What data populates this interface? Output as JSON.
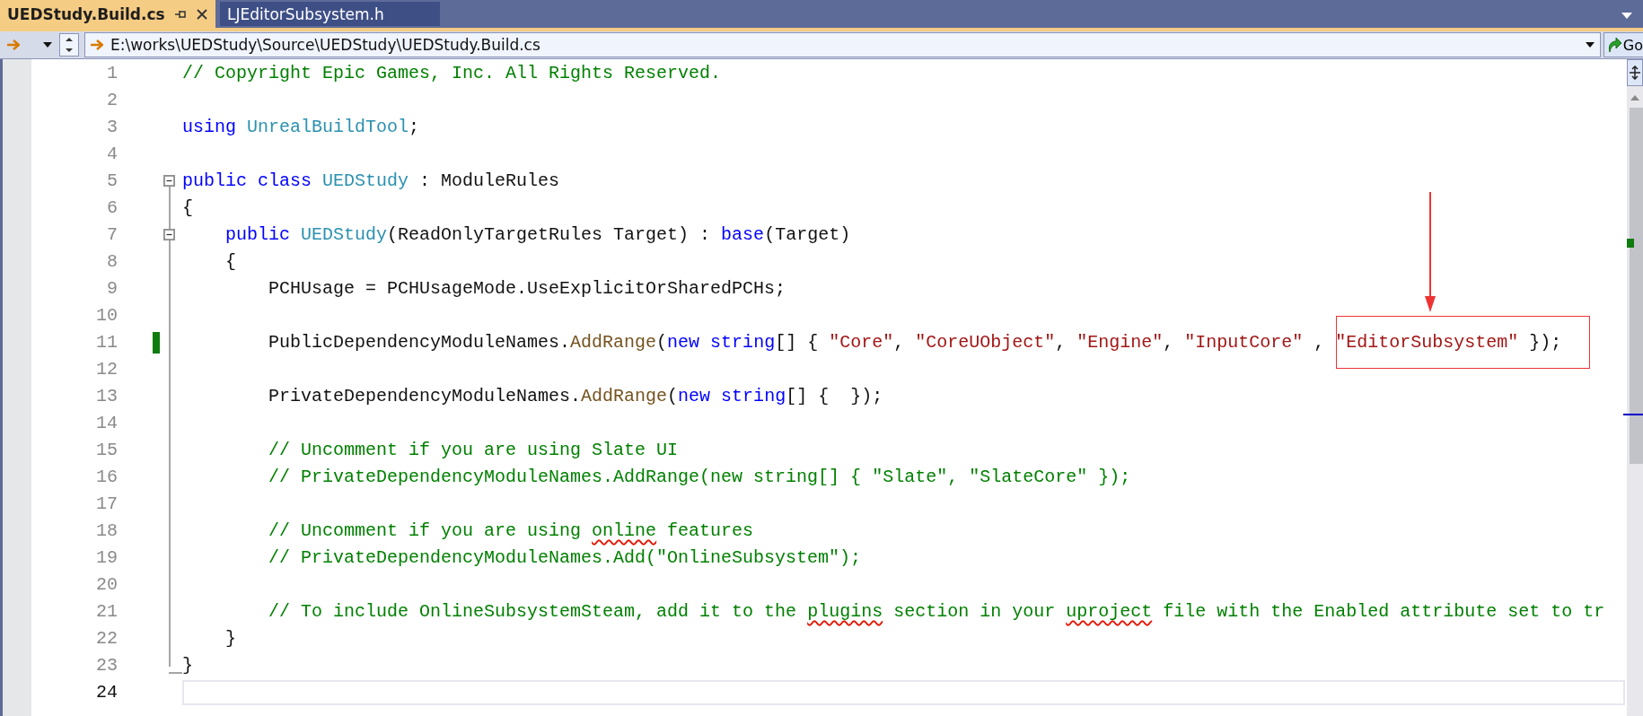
{
  "tabs": [
    {
      "label": "UEDStudy.Build.cs",
      "selected": true
    },
    {
      "label": "LJEditorSubsystem.h",
      "selected": false
    }
  ],
  "navigation": {
    "path": "E:\\works\\UEDStudy\\Source\\UEDStudy\\UEDStudy.Build.cs",
    "go_label": "Go"
  },
  "editor": {
    "lines": [
      {
        "number": "1",
        "current": false,
        "changed": false,
        "collapse_box": false,
        "outline_end": false,
        "tokens": [
          {
            "kind": "comment",
            "text": "// Copyright Epic Games, Inc. All Rights Reserved."
          }
        ]
      },
      {
        "number": "2",
        "current": false,
        "changed": false,
        "collapse_box": false,
        "outline_end": false
      },
      {
        "number": "3",
        "current": false,
        "changed": false,
        "collapse_box": false,
        "outline_end": false,
        "tokens": [
          {
            "kind": "keyword",
            "text": "using "
          },
          {
            "kind": "type",
            "text": "UnrealBuildTool"
          },
          {
            "kind": "plain",
            "text": ";"
          }
        ]
      },
      {
        "number": "4",
        "current": false,
        "changed": false,
        "collapse_box": false,
        "outline_end": false
      },
      {
        "number": "5",
        "current": false,
        "changed": false,
        "collapse_box": true,
        "outline_end": false,
        "tokens": [
          {
            "kind": "keyword",
            "text": "public class "
          },
          {
            "kind": "type",
            "text": "UEDStudy"
          },
          {
            "kind": "plain",
            "text": " : ModuleRules"
          }
        ]
      },
      {
        "number": "6",
        "current": false,
        "changed": false,
        "collapse_box": false,
        "outline_end": false,
        "tokens": [
          {
            "kind": "plain",
            "text": "{"
          }
        ]
      },
      {
        "number": "7",
        "current": false,
        "changed": false,
        "collapse_box": true,
        "outline_end": false,
        "tokens": [
          {
            "kind": "keyword",
            "text": "    public "
          },
          {
            "kind": "type",
            "text": "UEDStudy"
          },
          {
            "kind": "plain",
            "text": "(ReadOnlyTargetRules Target) : "
          },
          {
            "kind": "keyword",
            "text": "base"
          },
          {
            "kind": "plain",
            "text": "(Target)"
          }
        ]
      },
      {
        "number": "8",
        "current": false,
        "changed": false,
        "collapse_box": false,
        "outline_end": false,
        "tokens": [
          {
            "kind": "plain",
            "text": "    {"
          }
        ]
      },
      {
        "number": "9",
        "current": false,
        "changed": false,
        "collapse_box": false,
        "outline_end": false,
        "tokens": [
          {
            "kind": "plain",
            "text": "        PCHUsage = PCHUsageMode.UseExplicitOrSharedPCHs;"
          }
        ]
      },
      {
        "number": "10",
        "current": false,
        "changed": false,
        "collapse_box": false,
        "outline_end": false
      },
      {
        "number": "11",
        "current": false,
        "changed": true,
        "collapse_box": false,
        "outline_end": false,
        "tokens": [
          {
            "kind": "plain",
            "text": "        PublicDependencyModuleNames."
          },
          {
            "kind": "method",
            "text": "AddRange"
          },
          {
            "kind": "plain",
            "text": "("
          },
          {
            "kind": "keyword",
            "text": "new string"
          },
          {
            "kind": "plain",
            "text": "[] { "
          },
          {
            "kind": "string",
            "text": "\"Core\""
          },
          {
            "kind": "plain",
            "text": ", "
          },
          {
            "kind": "string",
            "text": "\"CoreUObject\""
          },
          {
            "kind": "plain",
            "text": ", "
          },
          {
            "kind": "string",
            "text": "\"Engine\""
          },
          {
            "kind": "plain",
            "text": ", "
          },
          {
            "kind": "string",
            "text": "\"InputCore\""
          },
          {
            "kind": "plain",
            "text": " , "
          },
          {
            "kind": "string",
            "text": "\"EditorSubsystem\""
          },
          {
            "kind": "plain",
            "text": " });"
          }
        ]
      },
      {
        "number": "12",
        "current": false,
        "changed": false,
        "collapse_box": false,
        "outline_end": false
      },
      {
        "number": "13",
        "current": false,
        "changed": false,
        "collapse_box": false,
        "outline_end": false,
        "tokens": [
          {
            "kind": "plain",
            "text": "        PrivateDependencyModuleNames."
          },
          {
            "kind": "method",
            "text": "AddRange"
          },
          {
            "kind": "plain",
            "text": "("
          },
          {
            "kind": "keyword",
            "text": "new string"
          },
          {
            "kind": "plain",
            "text": "[] {  });"
          }
        ]
      },
      {
        "number": "14",
        "current": false,
        "changed": false,
        "collapse_box": false,
        "outline_end": false
      },
      {
        "number": "15",
        "current": false,
        "changed": false,
        "collapse_box": false,
        "outline_end": false,
        "tokens": [
          {
            "kind": "comment",
            "text": "        // Uncomment if you are using Slate UI"
          }
        ]
      },
      {
        "number": "16",
        "current": false,
        "changed": false,
        "collapse_box": false,
        "outline_end": false,
        "tokens": [
          {
            "kind": "comment",
            "text": "        // PrivateDependencyModuleNames.AddRange(new string[] { \"Slate\", \"SlateCore\" });"
          }
        ]
      },
      {
        "number": "17",
        "current": false,
        "changed": false,
        "collapse_box": false,
        "outline_end": false
      },
      {
        "number": "18",
        "current": false,
        "changed": false,
        "collapse_box": false,
        "outline_end": false,
        "tokens": [
          {
            "kind": "comment",
            "text": "        // Uncomment if you are using "
          },
          {
            "kind": "spelling",
            "text": "online"
          },
          {
            "kind": "comment",
            "text": " features"
          }
        ]
      },
      {
        "number": "19",
        "current": false,
        "changed": false,
        "collapse_box": false,
        "outline_end": false,
        "tokens": [
          {
            "kind": "comment",
            "text": "        // PrivateDependencyModuleNames.Add(\"OnlineSubsystem\");"
          }
        ]
      },
      {
        "number": "20",
        "current": false,
        "changed": false,
        "collapse_box": false,
        "outline_end": false
      },
      {
        "number": "21",
        "current": false,
        "changed": false,
        "collapse_box": false,
        "outline_end": false,
        "tokens": [
          {
            "kind": "comment",
            "text": "        // To include OnlineSubsystemSteam, add it to the "
          },
          {
            "kind": "spelling",
            "text": "plugins"
          },
          {
            "kind": "comment",
            "text": " section in your "
          },
          {
            "kind": "spelling",
            "text": "uproject"
          },
          {
            "kind": "comment",
            "text": " file with the Enabled attribute set to tr"
          }
        ]
      },
      {
        "number": "22",
        "current": false,
        "changed": false,
        "collapse_box": false,
        "outline_end": false,
        "tokens": [
          {
            "kind": "plain",
            "text": "    }"
          }
        ]
      },
      {
        "number": "23",
        "current": false,
        "changed": false,
        "collapse_box": false,
        "outline_end": true,
        "tokens": [
          {
            "kind": "plain",
            "text": "}"
          }
        ]
      },
      {
        "number": "24",
        "current": true,
        "changed": false,
        "collapse_box": false,
        "outline_end": false
      }
    ]
  },
  "annotation": {
    "kind": "box-with-arrow"
  }
}
